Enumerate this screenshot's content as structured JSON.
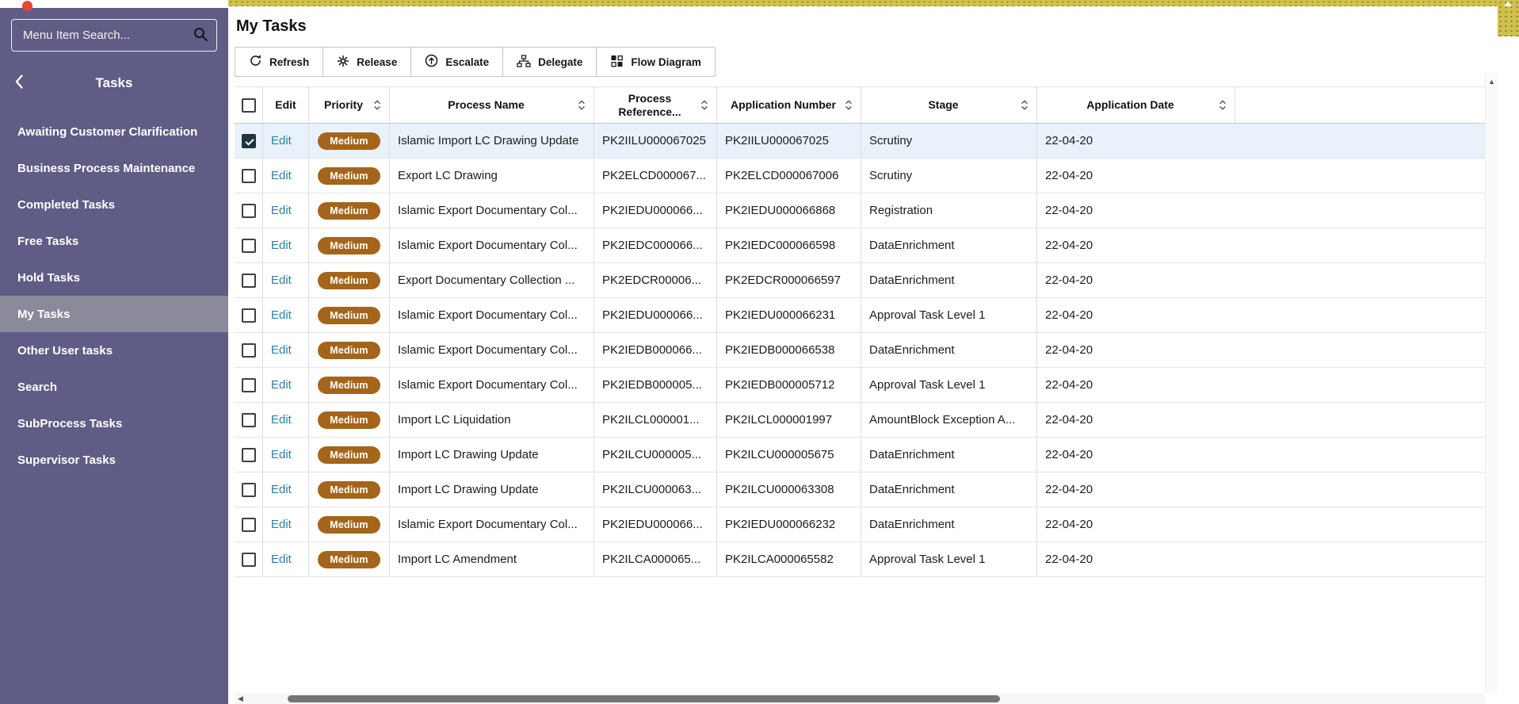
{
  "sidebar": {
    "search": {
      "placeholder": "Menu Item Search...",
      "icon": "search-icon"
    },
    "back_icon": "chevron-left-icon",
    "title": "Tasks",
    "items": [
      {
        "label": "Awaiting Customer Clarification",
        "selected": false
      },
      {
        "label": "Business Process Maintenance",
        "selected": false
      },
      {
        "label": "Completed Tasks",
        "selected": false
      },
      {
        "label": "Free Tasks",
        "selected": false
      },
      {
        "label": "Hold Tasks",
        "selected": false
      },
      {
        "label": "My Tasks",
        "selected": true
      },
      {
        "label": "Other User tasks",
        "selected": false
      },
      {
        "label": "Search",
        "selected": false
      },
      {
        "label": "SubProcess Tasks",
        "selected": false
      },
      {
        "label": "Supervisor Tasks",
        "selected": false
      }
    ]
  },
  "header": {
    "title": "My Tasks"
  },
  "toolbar": {
    "buttons": [
      {
        "label": "Refresh",
        "icon": "refresh-icon"
      },
      {
        "label": "Release",
        "icon": "release-icon"
      },
      {
        "label": "Escalate",
        "icon": "escalate-icon"
      },
      {
        "label": "Delegate",
        "icon": "delegate-icon"
      },
      {
        "label": "Flow Diagram",
        "icon": "flow-diagram-icon"
      }
    ]
  },
  "table": {
    "columns": [
      "Edit",
      "Priority",
      "Process Name",
      "Process Reference...",
      "Application Number",
      "Stage",
      "Application Date"
    ],
    "rows": [
      {
        "checked": true,
        "selected": true,
        "edit": "Edit",
        "priority": "Medium",
        "name": "Islamic Import LC Drawing Update",
        "ref": "PK2IILU000067025",
        "app": "PK2IILU000067025",
        "stage": "Scrutiny",
        "date": "22-04-20"
      },
      {
        "checked": false,
        "selected": false,
        "edit": "Edit",
        "priority": "Medium",
        "name": "Export LC Drawing",
        "ref": "PK2ELCD000067...",
        "app": "PK2ELCD000067006",
        "stage": "Scrutiny",
        "date": "22-04-20"
      },
      {
        "checked": false,
        "selected": false,
        "edit": "Edit",
        "priority": "Medium",
        "name": "Islamic Export Documentary Col...",
        "ref": "PK2IEDU000066...",
        "app": "PK2IEDU000066868",
        "stage": "Registration",
        "date": "22-04-20"
      },
      {
        "checked": false,
        "selected": false,
        "edit": "Edit",
        "priority": "Medium",
        "name": "Islamic Export Documentary Col...",
        "ref": "PK2IEDC000066...",
        "app": "PK2IEDC000066598",
        "stage": "DataEnrichment",
        "date": "22-04-20"
      },
      {
        "checked": false,
        "selected": false,
        "edit": "Edit",
        "priority": "Medium",
        "name": "Export Documentary Collection ...",
        "ref": "PK2EDCR00006...",
        "app": "PK2EDCR000066597",
        "stage": "DataEnrichment",
        "date": "22-04-20"
      },
      {
        "checked": false,
        "selected": false,
        "edit": "Edit",
        "priority": "Medium",
        "name": "Islamic Export Documentary Col...",
        "ref": "PK2IEDU000066...",
        "app": "PK2IEDU000066231",
        "stage": "Approval Task Level 1",
        "date": "22-04-20"
      },
      {
        "checked": false,
        "selected": false,
        "edit": "Edit",
        "priority": "Medium",
        "name": "Islamic Export Documentary Col...",
        "ref": "PK2IEDB000066...",
        "app": "PK2IEDB000066538",
        "stage": "DataEnrichment",
        "date": "22-04-20"
      },
      {
        "checked": false,
        "selected": false,
        "edit": "Edit",
        "priority": "Medium",
        "name": "Islamic Export Documentary Col...",
        "ref": "PK2IEDB000005...",
        "app": "PK2IEDB000005712",
        "stage": "Approval Task Level 1",
        "date": "22-04-20"
      },
      {
        "checked": false,
        "selected": false,
        "edit": "Edit",
        "priority": "Medium",
        "name": "Import LC Liquidation",
        "ref": "PK2ILCL000001...",
        "app": "PK2ILCL000001997",
        "stage": "AmountBlock Exception A...",
        "date": "22-04-20"
      },
      {
        "checked": false,
        "selected": false,
        "edit": "Edit",
        "priority": "Medium",
        "name": "Import LC Drawing Update",
        "ref": "PK2ILCU000005...",
        "app": "PK2ILCU000005675",
        "stage": "DataEnrichment",
        "date": "22-04-20"
      },
      {
        "checked": false,
        "selected": false,
        "edit": "Edit",
        "priority": "Medium",
        "name": "Import LC Drawing Update",
        "ref": "PK2ILCU000063...",
        "app": "PK2ILCU000063308",
        "stage": "DataEnrichment",
        "date": "22-04-20"
      },
      {
        "checked": false,
        "selected": false,
        "edit": "Edit",
        "priority": "Medium",
        "name": "Islamic Export Documentary Col...",
        "ref": "PK2IEDU000066...",
        "app": "PK2IEDU000066232",
        "stage": "DataEnrichment",
        "date": "22-04-20"
      },
      {
        "checked": false,
        "selected": false,
        "edit": "Edit",
        "priority": "Medium",
        "name": "Import LC Amendment",
        "ref": "PK2ILCA000065...",
        "app": "PK2ILCA000065582",
        "stage": "Approval Task Level 1",
        "date": "22-04-20"
      }
    ]
  },
  "scrollbar": {
    "up_arrow": "▲",
    "left_arrow": "◀"
  },
  "colors": {
    "sidebar_bg": "#5f5d85",
    "sidebar_selected_bg": "#8a8a9b",
    "priority_badge_bg": "#a4651b",
    "edit_link": "#2e7daa",
    "selected_row_bg": "#e9f2fb",
    "top_strip": "#cfc14c",
    "record_dot": "#e8443a"
  }
}
